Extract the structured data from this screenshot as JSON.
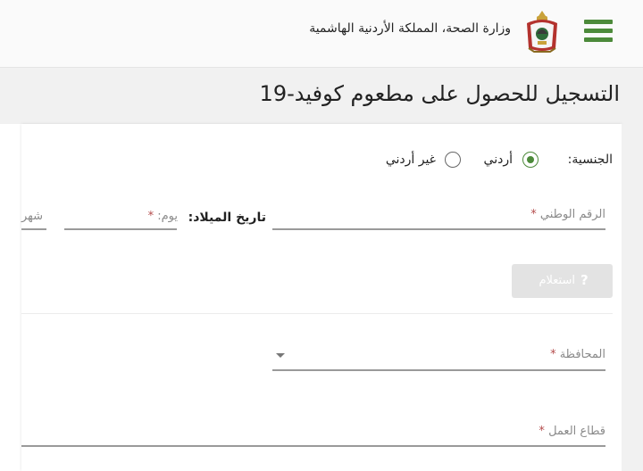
{
  "header": {
    "ministry": "وزارة الصحة، المملكة الأردنية الهاشمية",
    "menu_icon": "hamburger-menu-icon",
    "logo_icon": "jordan-coat-of-arms-icon",
    "accent_color": "#4c8a3a"
  },
  "page": {
    "title": "التسجيل للحصول على مطعوم كوفيد-19"
  },
  "form": {
    "nationality": {
      "label": "الجنسية:",
      "options": [
        "أردني",
        "غير أردني"
      ],
      "selected": "أردني"
    },
    "national_id": {
      "placeholder": "الرقم الوطني",
      "required_mark": "*"
    },
    "birth_date": {
      "label": "تاريخ الميلاد:",
      "day_placeholder": "يوم",
      "day_required_mark": "*",
      "month_placeholder": "شهر"
    },
    "inquiry_button": {
      "label": "استعلام",
      "icon": "question-icon",
      "icon_glyph": "?"
    },
    "governorate": {
      "placeholder": "المحافظة",
      "required_mark": "*"
    },
    "work_sector": {
      "placeholder": "قطاع العمل",
      "required_mark": "*"
    }
  }
}
